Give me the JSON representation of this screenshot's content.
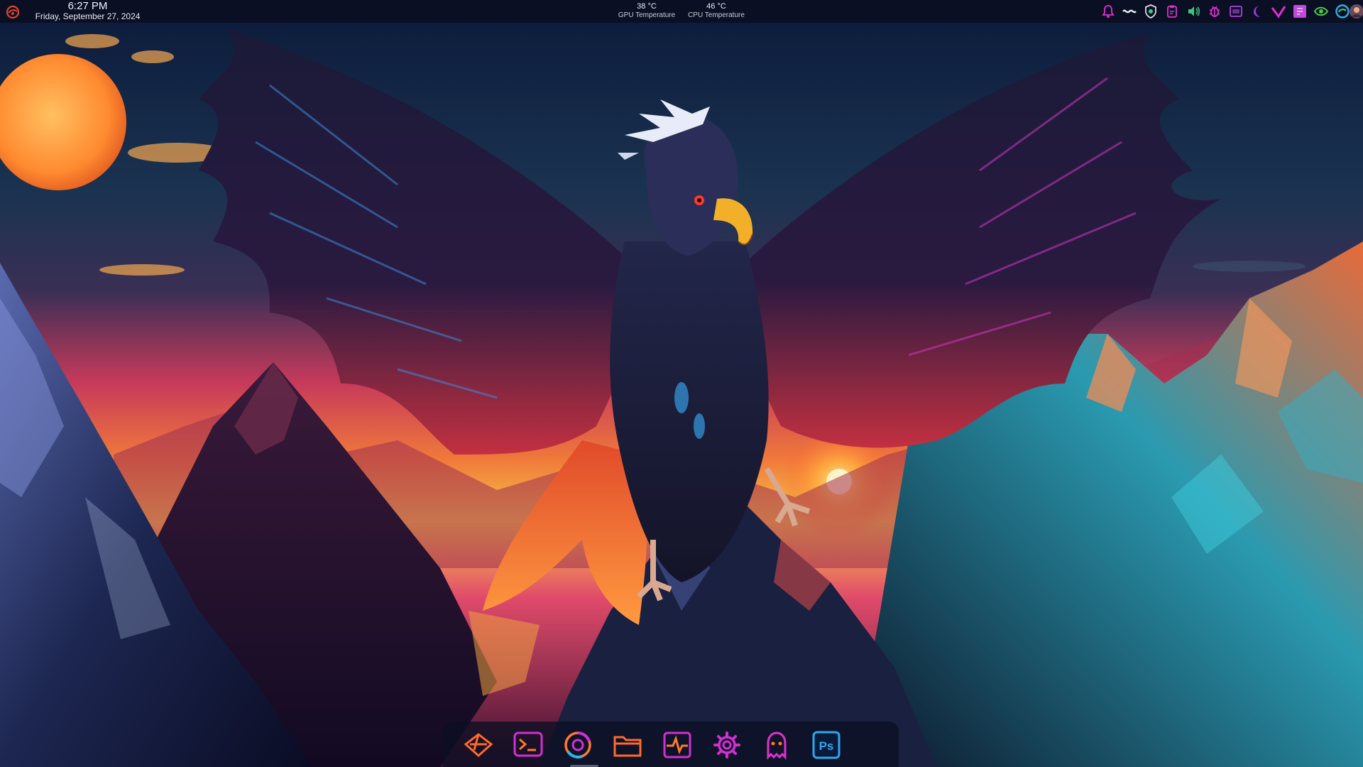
{
  "clock": {
    "time": "6:27 PM",
    "date": "Friday, September 27, 2024"
  },
  "sensors": [
    {
      "value": "38 °C",
      "label": "GPU Temperature"
    },
    {
      "value": "46 °C",
      "label": "CPU Temperature"
    }
  ],
  "launcher": {
    "icon": "menu-logo-icon"
  },
  "tray": {
    "icons": [
      "notification-bell-icon",
      "wave-icon",
      "shield-icon",
      "clipboard-icon",
      "volume-icon",
      "bug-icon",
      "storage-icon",
      "night-mode-icon",
      "vpn-check-icon",
      "app-grid-icon",
      "nvidia-icon",
      "edge-browser-icon",
      "user-avatar-icon"
    ]
  },
  "dock": {
    "items": [
      {
        "name": "app-launcher",
        "icon": "launcher-logo-icon"
      },
      {
        "name": "terminal",
        "icon": "terminal-icon"
      },
      {
        "name": "chrome-browser",
        "icon": "chrome-icon",
        "active": true
      },
      {
        "name": "file-manager",
        "icon": "folder-icon"
      },
      {
        "name": "system-monitor",
        "icon": "system-monitor-icon"
      },
      {
        "name": "settings",
        "icon": "settings-gear-icon"
      },
      {
        "name": "ghost-app",
        "icon": "ghost-icon"
      },
      {
        "name": "photoshop",
        "icon": "photoshop-icon",
        "label": "Ps"
      }
    ]
  },
  "colors": {
    "accent_magenta": "#d61fd6",
    "accent_orange": "#ff7a2a",
    "accent_cyan": "#2ab8e8",
    "panel_bg": "#0a0e20"
  }
}
